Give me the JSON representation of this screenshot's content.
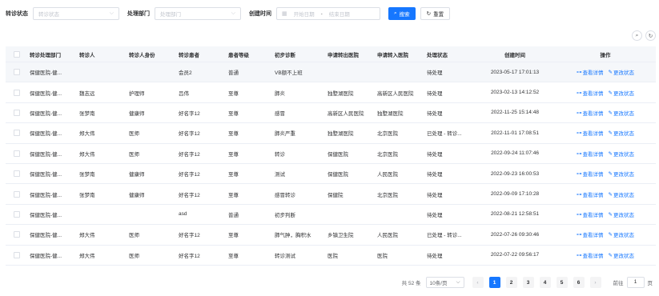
{
  "filters": {
    "status_label": "转诊状态",
    "status_placeholder": "转诊状态",
    "dept_label": "处理部门",
    "dept_placeholder": "处理部门",
    "time_label": "创建时间",
    "start_placeholder": "开始日期",
    "range_sep": "-",
    "end_placeholder": "结束日期",
    "search_label": "搜索",
    "reset_label": "重置"
  },
  "toolbar": {
    "search_icon": "search-icon",
    "refresh_icon": "refresh-icon"
  },
  "table": {
    "headers": [
      "转诊处理部门",
      "转诊人",
      "转诊人身份",
      "转诊患者",
      "患者等级",
      "初步诊断",
      "申请转出医院",
      "申请转入医院",
      "处理状态",
      "创建时间",
      "操作"
    ],
    "view_label": "查看详情",
    "change_label": "更改状态",
    "rows": [
      {
        "dept": "保健医院-健...",
        "person": "",
        "role": "",
        "patient": "会员2",
        "level": "普通",
        "diagnosis": "VB额不上班",
        "from": "",
        "to": "",
        "status": "待处理",
        "time": "2023-05-17 17:01:13"
      },
      {
        "dept": "保健医院-健...",
        "person": "魏志远",
        "role": "护理师",
        "patient": "吕伟",
        "level": "至尊",
        "diagnosis": "肺炎",
        "from": "独墅湖医院",
        "to": "高新区人民医院",
        "status": "待处理",
        "time": "2023-02-13 14:12:52"
      },
      {
        "dept": "保健医院-健...",
        "person": "张梦南",
        "role": "健康师",
        "patient": "好名字12",
        "level": "至尊",
        "diagnosis": "感冒",
        "from": "高新区人民医院",
        "to": "独墅湖医院",
        "status": "待处理",
        "time": "2022-11-25 15:14:48"
      },
      {
        "dept": "保健医院-健...",
        "person": "郑大伟",
        "role": "医师",
        "patient": "好名字12",
        "level": "至尊",
        "diagnosis": "肺炎严重",
        "from": "独墅湖医院",
        "to": "北京医院",
        "status": "已处理 - 转诊...",
        "time": "2022-11-01 17:08:51"
      },
      {
        "dept": "保健医院-健...",
        "person": "郑大伟",
        "role": "医师",
        "patient": "好名字12",
        "level": "至尊",
        "diagnosis": "转诊",
        "from": "保健医院",
        "to": "北京医院",
        "status": "待处理",
        "time": "2022-09-24 11:07:46"
      },
      {
        "dept": "保健医院-健...",
        "person": "张梦南",
        "role": "健康师",
        "patient": "好名字12",
        "level": "至尊",
        "diagnosis": "测试",
        "from": "保健医院",
        "to": "人民医院",
        "status": "待处理",
        "time": "2022-09-23 16:00:53"
      },
      {
        "dept": "保健医院-健...",
        "person": "张梦南",
        "role": "健康师",
        "patient": "好名字12",
        "level": "至尊",
        "diagnosis": "感冒转诊",
        "from": "保健院",
        "to": "北京医院",
        "status": "待处理",
        "time": "2022-09-09 17:10:28"
      },
      {
        "dept": "保健医院-健...",
        "person": "",
        "role": "",
        "patient": "asd",
        "level": "普通",
        "diagnosis": "初步判断",
        "from": "",
        "to": "",
        "status": "待处理",
        "time": "2022-08-21 12:58:51"
      },
      {
        "dept": "保健医院-健...",
        "person": "郑大伟",
        "role": "医师",
        "patient": "好名字12",
        "level": "至尊",
        "diagnosis": "肺气肿，胸积水",
        "from": "乡镇卫生院",
        "to": "人民医院",
        "status": "已处理 - 转诊...",
        "time": "2022-07-26 09:30:46"
      },
      {
        "dept": "保健医院-健...",
        "person": "郑大伟",
        "role": "医师",
        "patient": "好名字12",
        "level": "至尊",
        "diagnosis": "转诊测试",
        "from": "医院",
        "to": "医院",
        "status": "待处理",
        "time": "2022-07-22 09:56:17"
      }
    ]
  },
  "pagination": {
    "total": "共 52 条",
    "page_size": "10条/页",
    "pages": [
      "1",
      "2",
      "3",
      "4",
      "5",
      "6"
    ],
    "current": "1",
    "goto_prefix": "前往",
    "goto_value": "1",
    "goto_suffix": "页"
  },
  "colors": {
    "primary": "#1677ff",
    "header_bg": "#f5f7fa",
    "border": "#ebeef5"
  }
}
